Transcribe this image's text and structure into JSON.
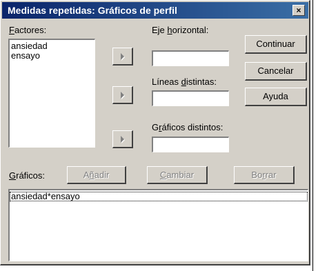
{
  "dialog": {
    "title": "Medidas repetidas: Gráficos de perfil",
    "close_symbol": "×"
  },
  "factores": {
    "label_u": "F",
    "label_rest": "actores:",
    "items": [
      "ansiedad",
      "ensayo"
    ]
  },
  "eje_horizontal": {
    "label_pre": "Eje ",
    "label_u": "h",
    "label_rest": "orizontal:",
    "value": ""
  },
  "lineas_distintas": {
    "label_pre": "Líneas ",
    "label_u": "d",
    "label_rest": "istintas:",
    "value": ""
  },
  "graficos_distintos": {
    "label_pre": "G",
    "label_u": "r",
    "label_rest": "áficos distintos:",
    "value": ""
  },
  "buttons": {
    "continuar": "Continuar",
    "cancelar": "Cancelar",
    "ayuda": "Ayuda"
  },
  "graficos": {
    "label_u": "G",
    "label_rest": "ráficos:",
    "anadir_pre": "A",
    "anadir_u": "ñ",
    "anadir_rest": "adir",
    "cambiar_u": "C",
    "cambiar_rest": "ambiar",
    "borrar_pre": "Bo",
    "borrar_u": "r",
    "borrar_rest": "rar",
    "items": [
      "ansiedad*ensayo"
    ]
  }
}
